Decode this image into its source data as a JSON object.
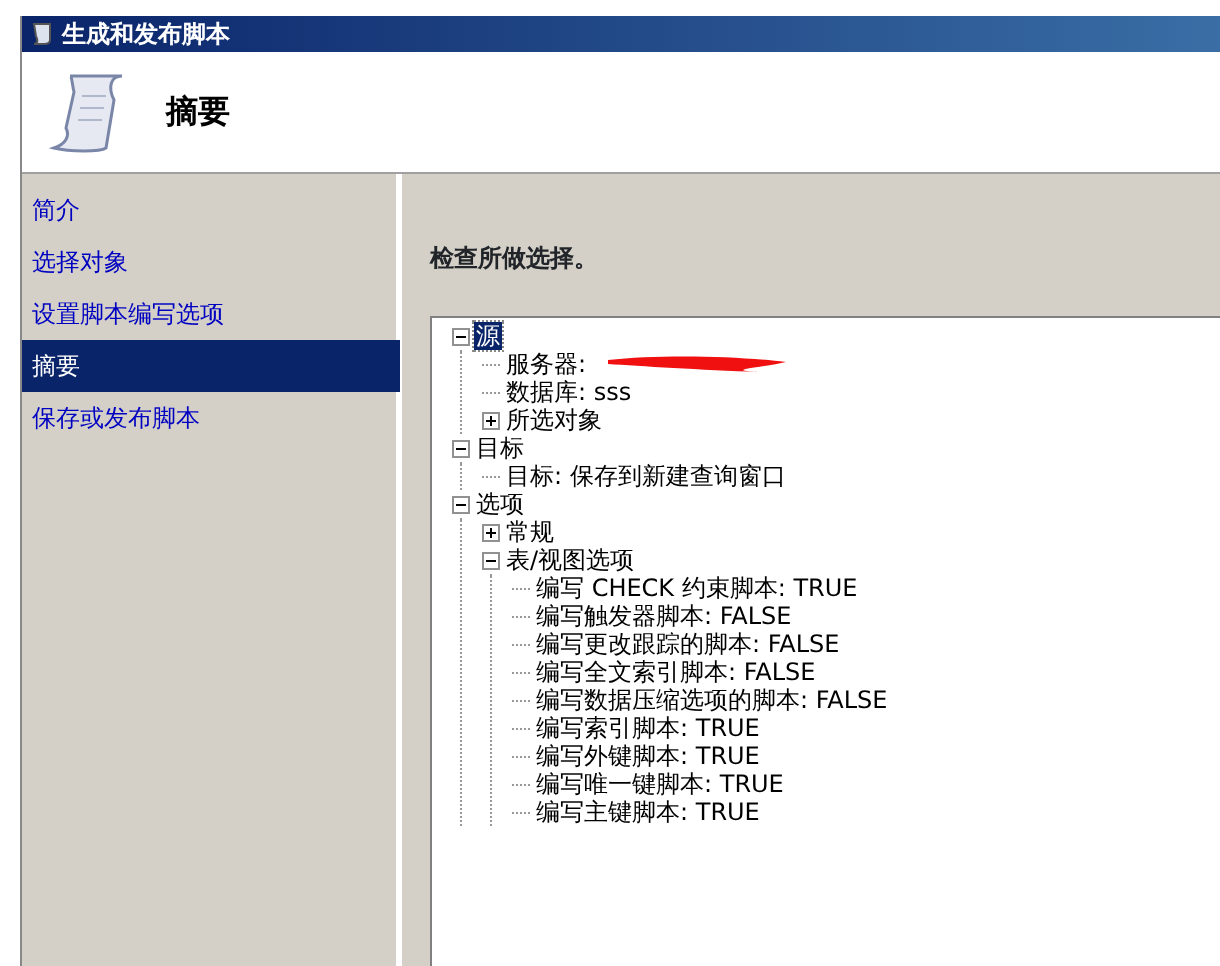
{
  "window": {
    "title": "生成和发布脚本"
  },
  "header": {
    "title": "摘要"
  },
  "sidebar": {
    "items": [
      {
        "label": "简介",
        "selected": false
      },
      {
        "label": "选择对象",
        "selected": false
      },
      {
        "label": "设置脚本编写选项",
        "selected": false
      },
      {
        "label": "摘要",
        "selected": true
      },
      {
        "label": "保存或发布脚本",
        "selected": false
      }
    ]
  },
  "main": {
    "heading": "检查所做选择。",
    "tree": [
      {
        "label": "源",
        "selected": true,
        "expanded": true,
        "children": [
          {
            "label": "服务器:",
            "redacted": true
          },
          {
            "label": "数据库: sss"
          },
          {
            "label": "所选对象",
            "expanded": false
          }
        ]
      },
      {
        "label": "目标",
        "selected": false,
        "expanded": true,
        "children": [
          {
            "label": "目标: 保存到新建查询窗口"
          }
        ]
      },
      {
        "label": "选项",
        "selected": false,
        "expanded": true,
        "children": [
          {
            "label": "常规",
            "expanded": false
          },
          {
            "label": "表/视图选项",
            "expanded": true,
            "children": [
              {
                "label": "编写 CHECK 约束脚本: TRUE"
              },
              {
                "label": "编写触发器脚本: FALSE"
              },
              {
                "label": "编写更改跟踪的脚本: FALSE"
              },
              {
                "label": "编写全文索引脚本: FALSE"
              },
              {
                "label": "编写数据压缩选项的脚本: FALSE"
              },
              {
                "label": "编写索引脚本: TRUE"
              },
              {
                "label": "编写外键脚本: TRUE"
              },
              {
                "label": "编写唯一键脚本: TRUE"
              },
              {
                "label": "编写主键脚本: TRUE"
              }
            ]
          }
        ]
      }
    ]
  }
}
